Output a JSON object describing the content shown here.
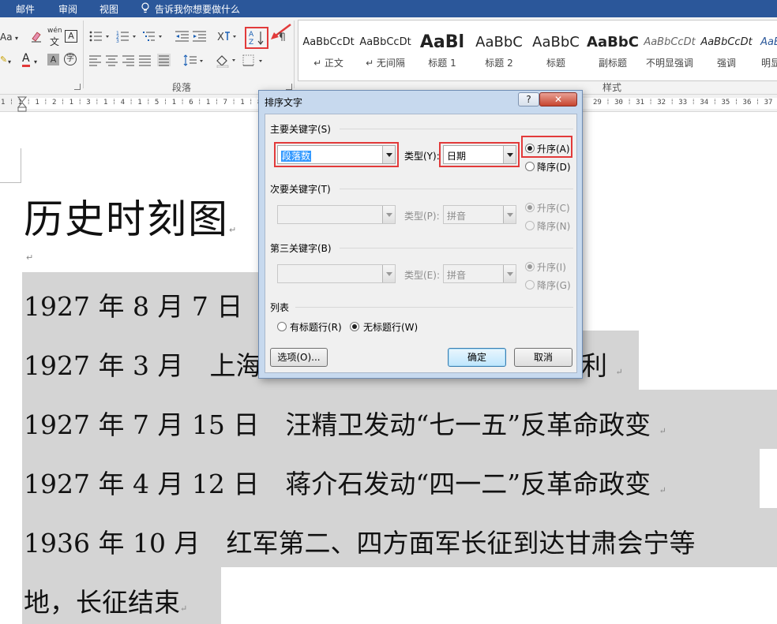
{
  "menu": {
    "items": [
      "邮件",
      "审阅",
      "视图"
    ],
    "tell_me": "告诉我你想要做什么"
  },
  "ribbon": {
    "font_aa_label": "Aa",
    "pinyin_label": "wén",
    "paragraph_group": "段落",
    "styles_group": "样式",
    "styles": [
      {
        "sample": "AaBbCcDt",
        "name": "↵ 正文"
      },
      {
        "sample": "AaBbCcDt",
        "name": "↵ 无间隔"
      },
      {
        "sample": "AaBl",
        "name": "标题 1"
      },
      {
        "sample": "AaBbC",
        "name": "标题 2"
      },
      {
        "sample": "AaBbC",
        "name": "标题"
      },
      {
        "sample": "AaBbC",
        "name": "副标题"
      },
      {
        "sample": "AaBbCcDt",
        "name": "不明显强调"
      },
      {
        "sample": "AaBbCcDt",
        "name": "强调"
      },
      {
        "sample": "AaB",
        "name": "明显"
      }
    ]
  },
  "ruler": {
    "left": "1 ⁞ 1 ⁞ 1 ⁞ 2 ⁞ 1 ⁞ 3 ⁞ 1 ⁞ 4 ⁞ 1 ⁞ 5 ⁞ 1 ⁞ 6 ⁞ 1 ⁞ 7 ⁞ 1 ⁞ 8 ⁞ 1 ⁞ 9 ⁞ 1 ⁞ 10 ⁞ 1 ⁞ 11",
    "right": "29 ⁞ 30 ⁞ 31 ⁞ 32 ⁞ 33 ⁞ 34 ⁞ 35 ⁞ 36 ⁞ 37 ⁞"
  },
  "document": {
    "title": "历史时刻图",
    "lines": [
      "1927 年 8 月 7 日",
      "1927 年 3 月　上海",
      "利",
      "1927 年 7 月 15 日　汪精卫发动“七一五”反革命政变",
      "1927 年 4 月 12 日　蒋介石发动“四一二”反革命政变",
      "1936 年 10 月　红军第二、四方面军长征到达甘肃会宁等",
      "地，长征结束"
    ]
  },
  "dialog": {
    "title": "排序文字",
    "help": "?",
    "close": "✕",
    "primary": {
      "label": "主要关键字(S)",
      "key": "段落数",
      "type_label": "类型(Y):",
      "type": "日期",
      "asc": "升序(A)",
      "desc": "降序(D)"
    },
    "secondary": {
      "label": "次要关键字(T)",
      "key": "",
      "type_label": "类型(P):",
      "type": "拼音",
      "asc": "升序(C)",
      "desc": "降序(N)"
    },
    "tertiary": {
      "label": "第三关键字(B)",
      "key": "",
      "type_label": "类型(E):",
      "type": "拼音",
      "asc": "升序(I)",
      "desc": "降序(G)"
    },
    "list": {
      "label": "列表",
      "header": "有标题行(R)",
      "no_header": "无标题行(W)",
      "selected": "无标题行(W)"
    },
    "options_button": "选项(O)...",
    "ok_button": "确定",
    "cancel_button": "取消"
  },
  "colors": {
    "accent": "#2b579a",
    "highlight": "#e23a3a",
    "selection": "#d4d4d4"
  }
}
